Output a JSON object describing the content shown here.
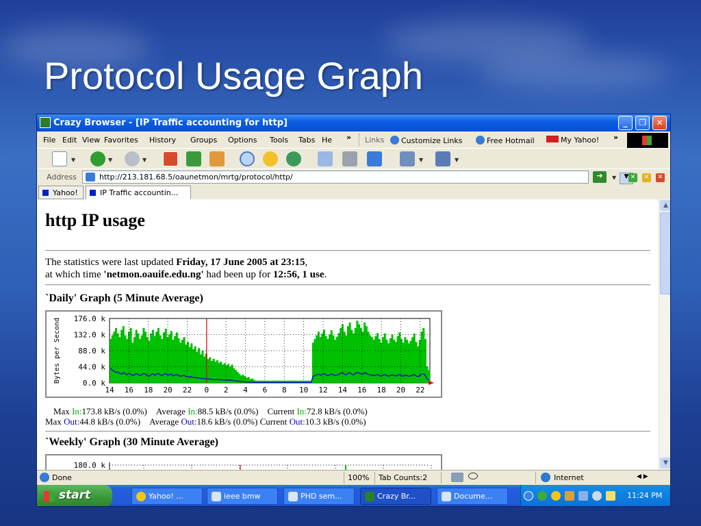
{
  "slide": {
    "title": "Protocol Usage Graph"
  },
  "window": {
    "title": "Crazy Browser - [IP Traffic accounting for http]"
  },
  "menu": {
    "items": [
      "File",
      "Edit",
      "View",
      "Favorites",
      "History",
      "Groups",
      "Options",
      "Tools",
      "Tabs",
      "He",
      "»"
    ],
    "links_label": "Links",
    "links": [
      "Customize Links",
      "Free Hotmail",
      "My Yahoo!"
    ],
    "links_more": "»"
  },
  "address": {
    "label": "Address",
    "url": "http://213.181.68.5/oaunetmon/mrtg/protocol/http/"
  },
  "tabs": [
    "Yahoo!",
    "IP Traffic accountin..."
  ],
  "page": {
    "heading": "http IP usage",
    "updated_prefix": "The statistics were last updated ",
    "updated_date": "Friday, 17 June 2005 at 23:15",
    "updated_suffix": ",",
    "uptime_prefix": "at which time ",
    "host": "'netmon.oauife.edu.ng'",
    "uptime_mid": " had been up for ",
    "uptime": "12:56, 1 use",
    "uptime_suffix": ".",
    "daily_title": "`Daily' Graph (5 Minute Average)",
    "weekly_title": "`Weekly' Graph (30 Minute Average)",
    "stats": {
      "max": "Max",
      "average": "Average",
      "current": "Current",
      "in_label": "In:",
      "out_label": "Out:",
      "max_in": "173.8 kB/s (0.0%)",
      "avg_in": "88.5 kB/s (0.0%)",
      "cur_in": "72.8 kB/s (0.0%)",
      "max_out": "44.8 kB/s (0.0%)",
      "avg_out": "18.6 kB/s (0.0%)",
      "cur_out": "10.3 kB/s (0.0%)"
    }
  },
  "status": {
    "done": "Done",
    "zoom": "100%",
    "tab_counts": "Tab Counts:2",
    "zone": "Internet",
    "nav": "◀ ▶"
  },
  "taskbar": {
    "start": "start",
    "tasks": [
      "Yahoo! ...",
      "ieee bmw",
      "PHD sem...",
      "Crazy Br...",
      "Docume..."
    ],
    "clock": "11:24 PM"
  },
  "colors": {
    "in": "#00c000",
    "out": "#0000cc",
    "titlebar": "#0550d6",
    "taskbar": "#245edb"
  },
  "chart_data": [
    {
      "type": "area",
      "title": "`Daily' Graph (5 Minute Average)",
      "ylabel": "Bytes per Second",
      "yticks": [
        "0.0 k",
        "44.0 k",
        "88.0 k",
        "132.0 k",
        "176.0 k"
      ],
      "ylim": [
        0,
        176
      ],
      "xticks": [
        "14",
        "16",
        "18",
        "20",
        "22",
        "0",
        "2",
        "4",
        "6",
        "8",
        "10",
        "12",
        "14",
        "16",
        "18",
        "20",
        "22"
      ],
      "grid": true,
      "series": [
        {
          "values": [
            120,
            130,
            140,
            150,
            135,
            125,
            145,
            155,
            130,
            120,
            140,
            150,
            110,
            125,
            145,
            135,
            120,
            130,
            150,
            140,
            125,
            115,
            135,
            145,
            128,
            140,
            150,
            130,
            120,
            138,
            148,
            125,
            132,
            142,
            118,
            128,
            138,
            122,
            110,
            118,
            125,
            105,
            112,
            98,
            108,
            92,
            100,
            85,
            95,
            78,
            88,
            72,
            80,
            65,
            70,
            60,
            66,
            58,
            62,
            55,
            58,
            50,
            54,
            48,
            52,
            45,
            50,
            40,
            35,
            30,
            25,
            20,
            22,
            18,
            14,
            16,
            10,
            12,
            8,
            6,
            6,
            6,
            6,
            6,
            6,
            6,
            6,
            6,
            6,
            6,
            6,
            6,
            6,
            6,
            6,
            6,
            6,
            6,
            6,
            6,
            6,
            6,
            6,
            6,
            6,
            6,
            6,
            6,
            6,
            6,
            110,
            120,
            130,
            140,
            125,
            135,
            145,
            128,
            120,
            132,
            144,
            130,
            118,
            126,
            136,
            150,
            160,
            140,
            130,
            155,
            165,
            145,
            135,
            150,
            170,
            160,
            150,
            140,
            165,
            155,
            140,
            130,
            125,
            118,
            128,
            136,
            120,
            110,
            125,
            135,
            118,
            108,
            122,
            132,
            118,
            112,
            128,
            138,
            120,
            110,
            125,
            118,
            108,
            115,
            125,
            135,
            112,
            100,
            118,
            140,
            150,
            120,
            45,
            35
          ]
        },
        {
          "values": [
            40,
            35,
            32,
            28,
            30,
            26,
            24,
            28,
            25,
            22,
            26,
            24,
            20,
            22,
            25,
            23,
            20,
            22,
            26,
            24,
            20,
            18,
            22,
            25,
            21,
            24,
            26,
            22,
            20,
            23,
            25,
            21,
            22,
            24,
            19,
            21,
            23,
            20,
            18,
            19,
            21,
            17,
            18,
            15,
            17,
            14,
            15,
            13,
            14,
            12,
            13,
            11,
            12,
            10,
            11,
            9,
            10,
            9,
            10,
            8,
            9,
            7,
            8,
            7,
            8,
            7,
            8,
            6,
            5,
            5,
            4,
            3,
            3,
            3,
            2,
            2,
            2,
            2,
            1,
            1,
            1,
            1,
            1,
            1,
            1,
            1,
            1,
            1,
            1,
            1,
            1,
            1,
            1,
            1,
            1,
            1,
            1,
            1,
            1,
            1,
            1,
            1,
            1,
            1,
            1,
            1,
            1,
            1,
            1,
            1,
            18,
            20,
            22,
            24,
            21,
            23,
            25,
            22,
            20,
            22,
            24,
            22,
            20,
            21,
            23,
            26,
            28,
            24,
            22,
            26,
            28,
            24,
            22,
            25,
            29,
            27,
            25,
            23,
            28,
            26,
            23,
            22,
            21,
            20,
            21,
            23,
            20,
            18,
            21,
            23,
            20,
            18,
            20,
            22,
            20,
            19,
            21,
            23,
            20,
            18,
            21,
            20,
            18,
            19,
            21,
            23,
            19,
            17,
            20,
            24,
            25,
            20,
            10,
            8
          ]
        }
      ]
    },
    {
      "type": "area",
      "title": "`Weekly' Graph (30 Minute Average)",
      "yticks": [
        "180.0 k"
      ],
      "grid": true
    }
  ]
}
